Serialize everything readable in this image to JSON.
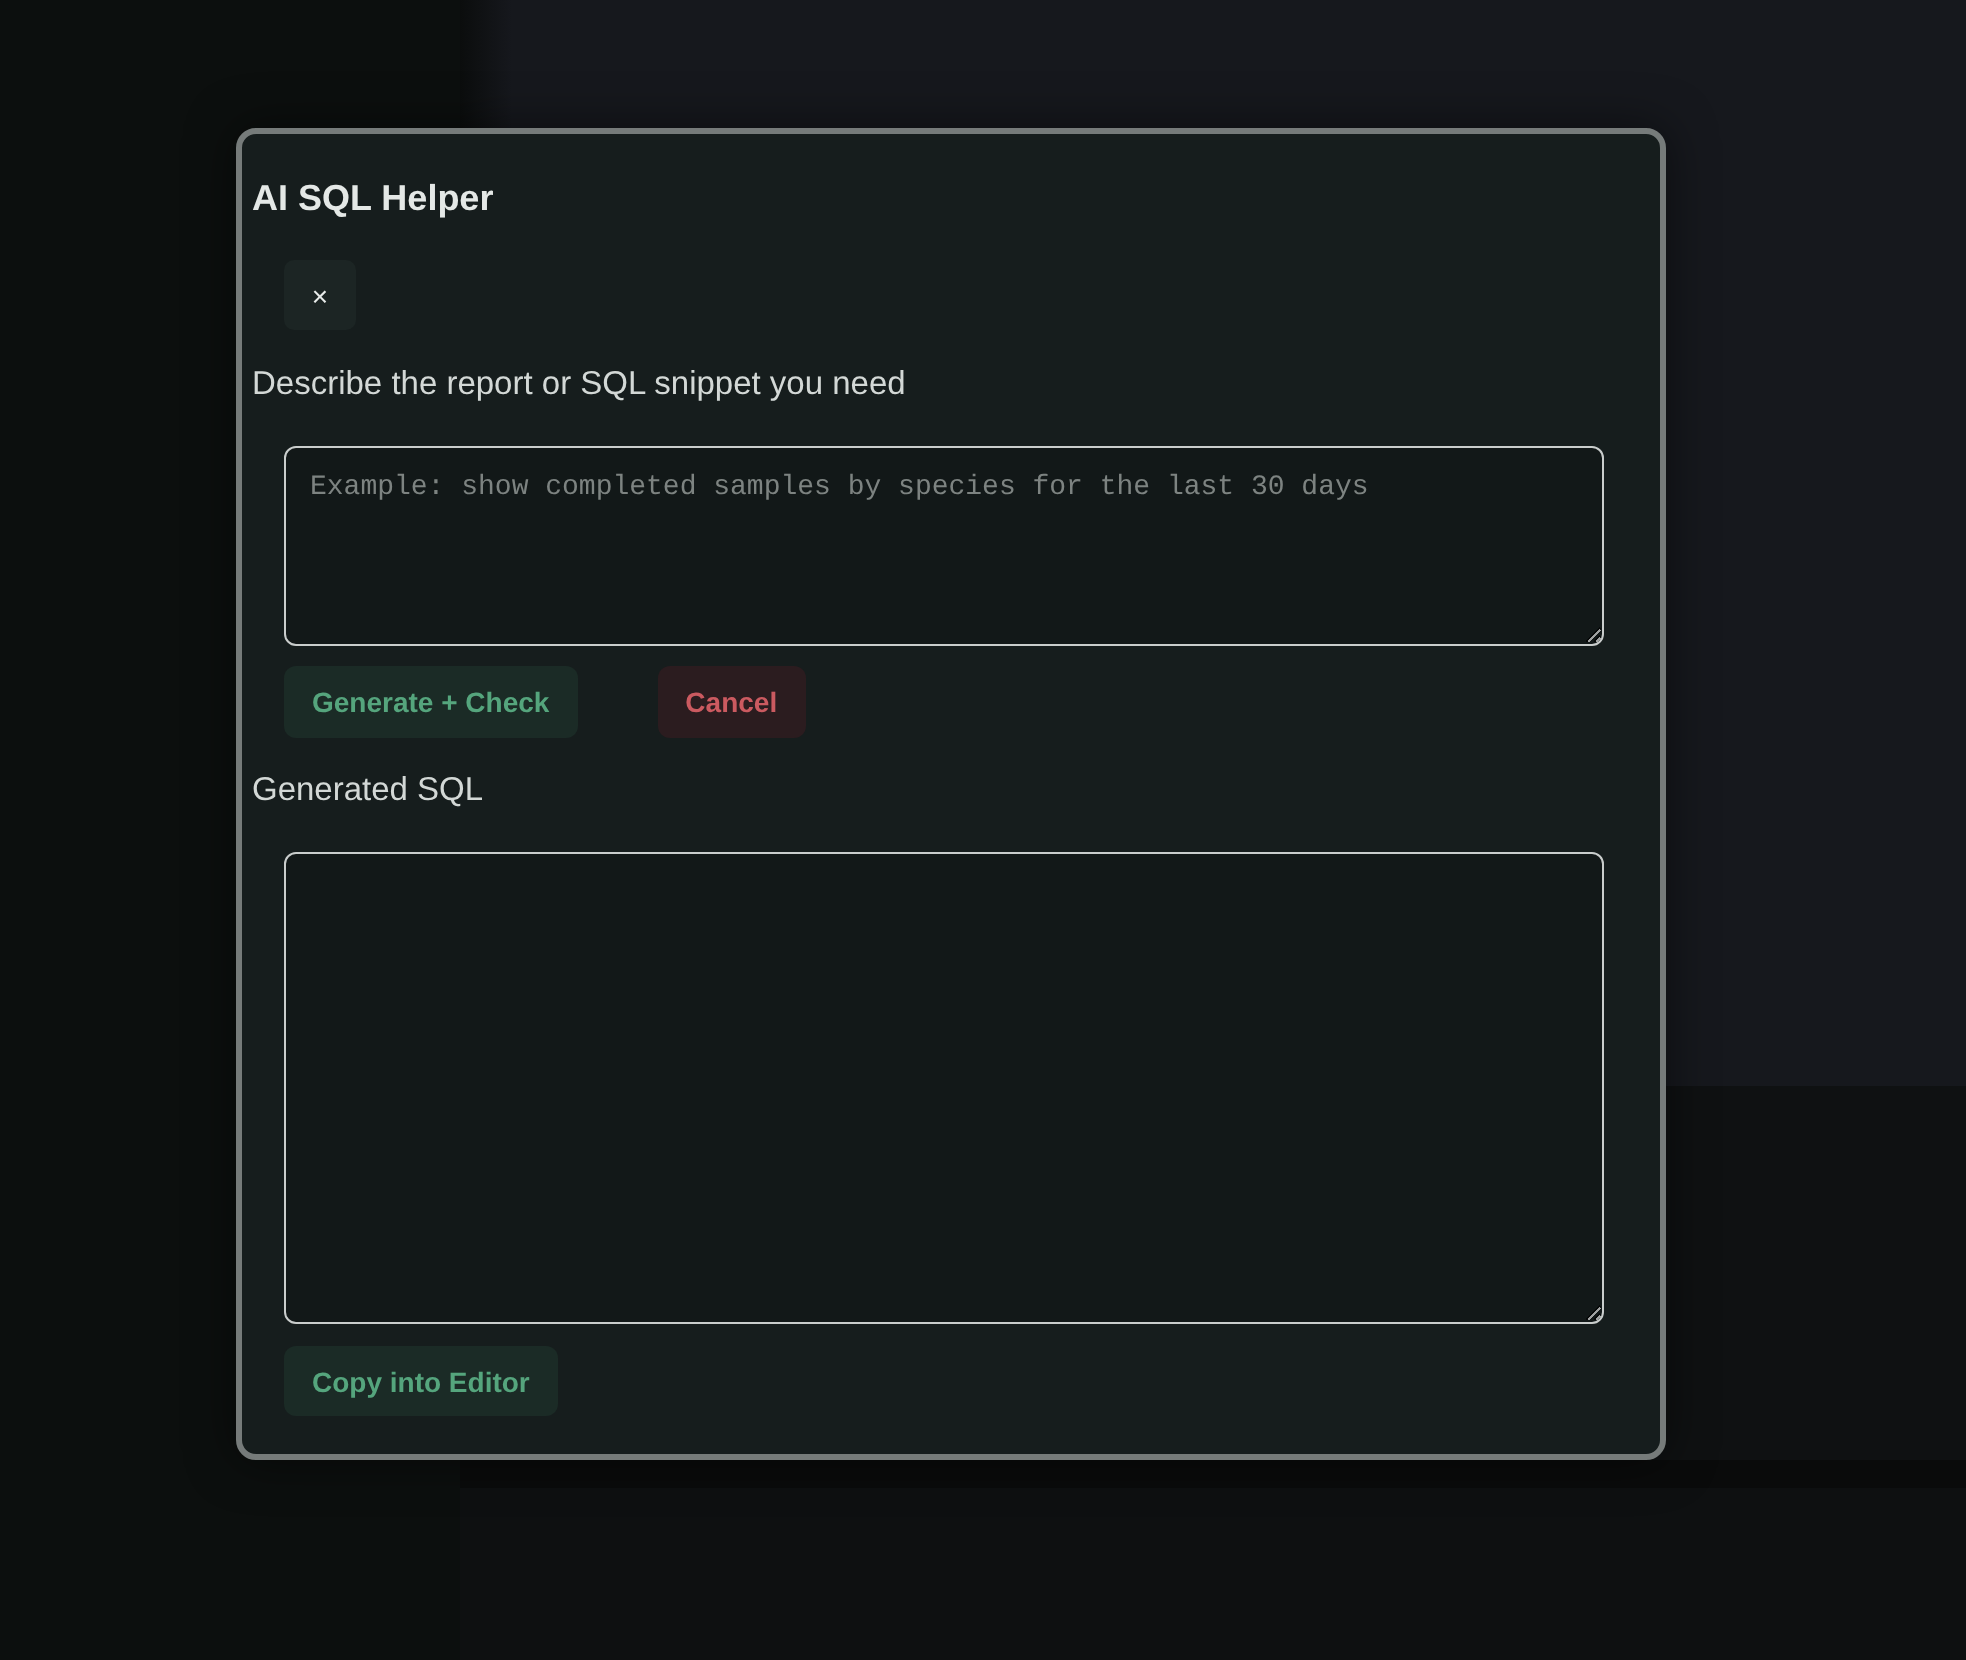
{
  "dialog": {
    "title": "AI SQL Helper",
    "close_button": "×",
    "prompt": {
      "label": "Describe the report or SQL snippet you need",
      "placeholder": "Example: show completed samples by species for the last 30 days"
    },
    "actions": [
      {
        "label": "Generate + Check",
        "kind": "primary"
      },
      {
        "label": "Cancel",
        "kind": "danger"
      }
    ],
    "output": {
      "label": "Generated SQL"
    },
    "copy_button": "Copy into Editor"
  }
}
